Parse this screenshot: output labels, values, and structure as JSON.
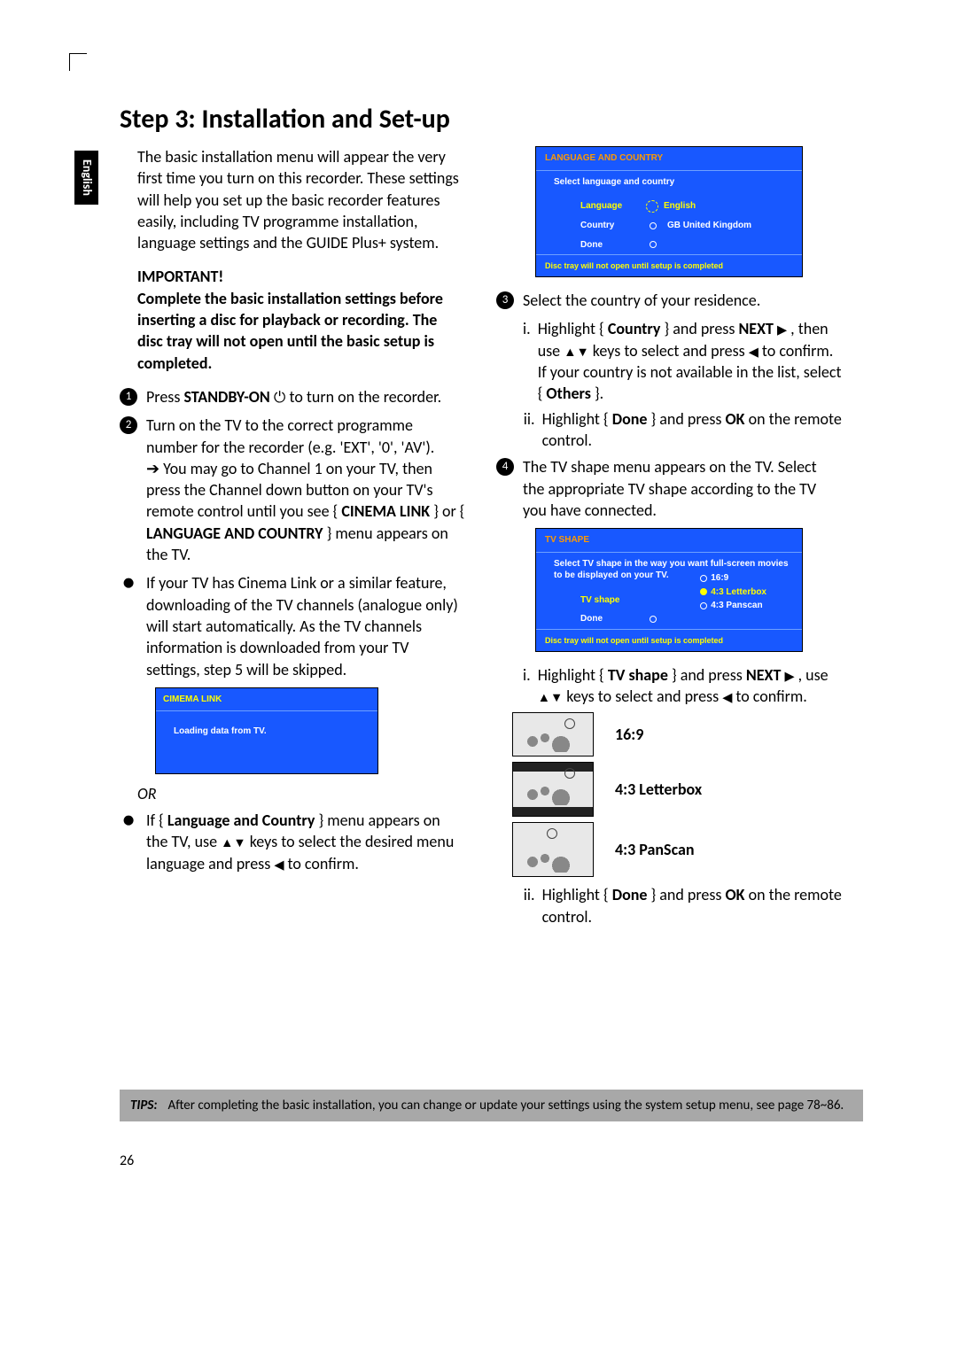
{
  "pageTitle": "Step 3: Installation and Set-up",
  "langTab": "English",
  "intro": "The basic installation menu will appear the very first time you turn on this recorder. These settings will help you set up the basic recorder features easily, including TV programme installation, language settings and the GUIDE Plus+ system.",
  "importantHdr": "IMPORTANT!",
  "importantBody": "Complete the basic installation settings before inserting a disc for playback or recording. The disc tray will not open until the basic setup is completed.",
  "step1_a": "Press ",
  "step1_b": "STANDBY-ON",
  "step1_c": " to turn on the recorder.",
  "step2": "Turn on the TV to the correct programme number for the recorder (e.g. 'EXT', '0', 'AV').",
  "step2b_arrow": "➔",
  "step2b": " You may go to Channel 1 on your TV, then press the Channel down button on your TV's remote control until you see { ",
  "step2b_m1": "CINEMA LINK",
  "step2b_mid": " } or { ",
  "step2b_m2": "LANGUAGE AND COUNTRY",
  "step2b_end": " } menu appears on the TV.",
  "bullet1": "If your TV has Cinema Link or a similar feature, downloading of the TV channels (analogue only) will start automatically. As the TV channels information is downloaded from your TV settings, step 5 will be skipped.",
  "cinemaHdr": "CIMEMA LINK",
  "cinemaBody": "Loading data from TV.",
  "orLbl": "OR",
  "bullet2_a": "If { ",
  "bullet2_b": "Language and Country",
  "bullet2_c": " } menu appears on the TV, use ",
  "bullet2_d": " keys to select the desired menu language and press ",
  "bullet2_e": " to confirm.",
  "screen1": {
    "title": "LANGUAGE AND COUNTRY",
    "sub": "Select language and country",
    "rows": {
      "lang_lbl": "Language",
      "lang_val": "English",
      "ctry_lbl": "Country",
      "ctry_val": "GB United Kingdom",
      "done": "Done"
    },
    "foot": "Disc tray will not open until setup is completed"
  },
  "step3": "Select the country of your residence.",
  "step3i_a": "Highlight { ",
  "step3i_b": "Country",
  "step3i_c": " } and press ",
  "step3i_d": "NEXT ",
  "step3i_e": " , then use ",
  "step3i_f": " keys to select and press ",
  "step3i_g": " to confirm. If your country is not available in the list, select { ",
  "step3i_h": "Others",
  "step3i_i": " }.",
  "step3ii_a": "Highlight { ",
  "step3ii_b": "Done",
  "step3ii_c": " } and press ",
  "step3ii_d": "OK",
  "step3ii_e": " on the remote control.",
  "step4": "The TV shape menu appears on the TV. Select the appropriate TV shape according to the TV you have connected.",
  "screen2": {
    "title": "TV SHAPE",
    "sub": "Select TV shape in the way you want full-screen movies to be displayed on your TV.",
    "tvshape_lbl": "TV shape",
    "done": "Done",
    "opts": {
      "o1": "16:9",
      "o2": "4:3 Letterbox",
      "o3": "4:3 Panscan"
    },
    "foot": "Disc tray will not open until setup is completed"
  },
  "step4i_a": "Highlight { ",
  "step4i_b": "TV shape",
  "step4i_c": " } and press ",
  "step4i_d": "NEXT ",
  "step4i_e": " , use ",
  "step4i_f": " keys to select and press ",
  "step4i_g": " to confirm.",
  "shapes": {
    "s169": "16:9",
    "slb": "4:3 Letterbox",
    "sps": "4:3 PanScan"
  },
  "step4ii_a": "Highlight { ",
  "step4ii_b": "Done",
  "step4ii_c": " } and press ",
  "step4ii_d": "OK",
  "step4ii_e": " on the remote control.",
  "tipsLbl": "TIPS:",
  "tipsBody": "After completing the basic installation, you can change or update your settings using the system setup menu, see page 78~86.",
  "pageNum": "26"
}
